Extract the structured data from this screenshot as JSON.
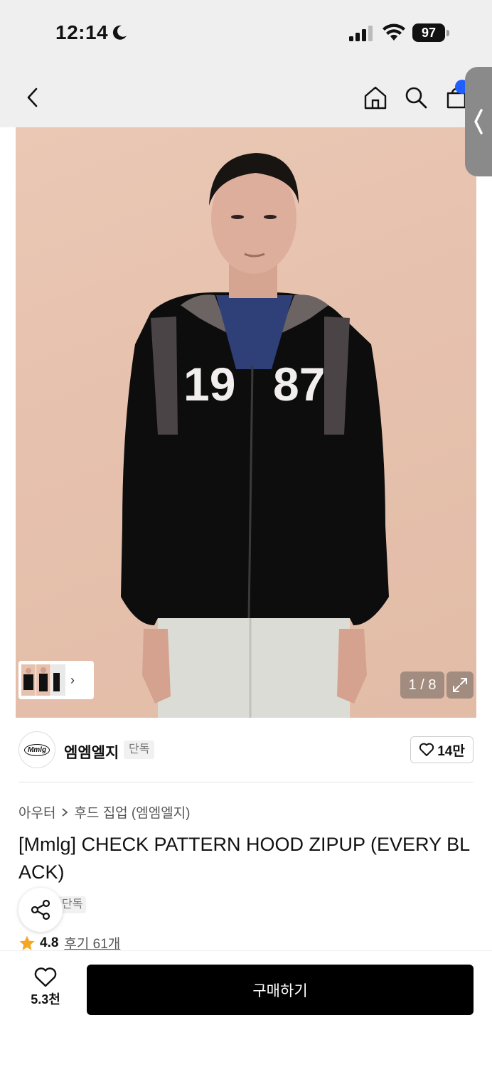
{
  "status_bar": {
    "time": "12:14",
    "battery": "97",
    "icons": [
      "moon-icon",
      "signal-icon",
      "wifi-icon",
      "battery-icon"
    ]
  },
  "nav": {
    "icons": [
      "back-arrow-icon",
      "home-icon",
      "search-icon",
      "shopping-bag-icon"
    ],
    "side_tab_icon": "chevron-left-icon"
  },
  "hero": {
    "page_counter": "1 / 8",
    "expand_icon": "expand-icon",
    "thumbnail_arrow": "›",
    "jersey_text_left": "19",
    "jersey_text_right": "87"
  },
  "brand": {
    "logo_text": "Mmlg",
    "name": "엠엠엘지",
    "tag": "단독",
    "like_count": "14만"
  },
  "product": {
    "breadcrumb": [
      "아우터",
      "후드 집업 (엠엠엘지)"
    ],
    "title": "[Mmlg] CHECK PATTERN HOOD ZIPUP (EVERY BLACK)",
    "exclusive_tag": "단독",
    "rating": "4.8",
    "review_link": "후기 61개"
  },
  "bottom_bar": {
    "wish_count": "5.3천",
    "buy_label": "구매하기"
  },
  "colors": {
    "accent_blue": "#1f5eff",
    "star": "#f5a623",
    "buy_button": "#000000",
    "hero_background": "#e6c1ad"
  }
}
